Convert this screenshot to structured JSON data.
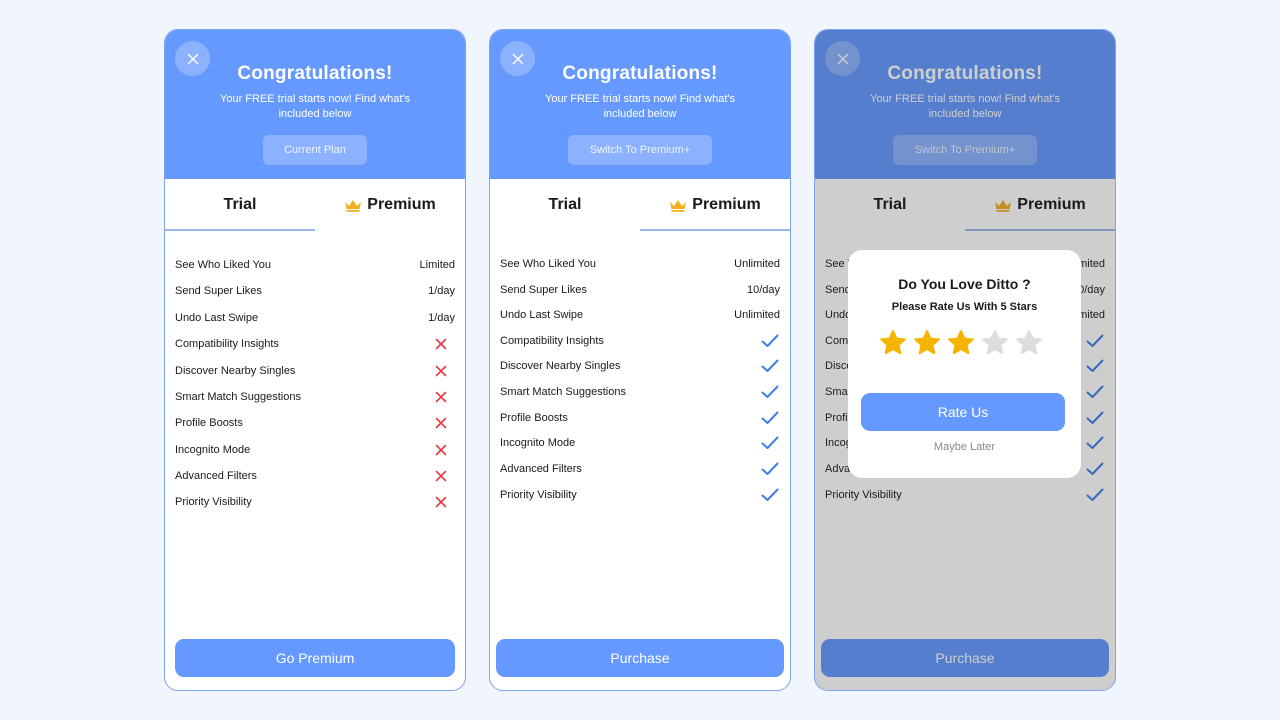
{
  "header": {
    "title": "Congratulations!",
    "subtitle": "Your FREE trial starts now! Find what's included below"
  },
  "tabs": {
    "trial": "Trial",
    "premium": "Premium"
  },
  "colors": {
    "primary": "#6699ff",
    "x_mark": "#e63946",
    "check_mark": "#3f7fe6",
    "star_filled": "#f4b400",
    "star_empty": "#dddddd",
    "crown": "#f2b01e"
  },
  "cards": [
    {
      "header_button": "Current Plan",
      "active_tab": "trial",
      "features": [
        {
          "name": "See Who Liked You",
          "value": "Limited"
        },
        {
          "name": "Send Super Likes",
          "value": "1/day"
        },
        {
          "name": "Undo Last Swipe",
          "value": "1/day"
        },
        {
          "name": "Compatibility Insights",
          "mark": "x-icon"
        },
        {
          "name": "Discover Nearby Singles",
          "mark": "x-icon"
        },
        {
          "name": "Smart Match Suggestions",
          "mark": "x-icon"
        },
        {
          "name": "Profile Boosts",
          "mark": "x-icon"
        },
        {
          "name": "Incognito Mode",
          "mark": "x-icon"
        },
        {
          "name": "Advanced Filters",
          "mark": "x-icon"
        },
        {
          "name": "Priority Visibility",
          "mark": "x-icon"
        }
      ],
      "cta": "Go Premium"
    },
    {
      "header_button": "Switch To Premium+",
      "active_tab": "premium",
      "features": [
        {
          "name": "See Who Liked You",
          "value": "Unlimited"
        },
        {
          "name": "Send Super Likes",
          "value": "10/day"
        },
        {
          "name": "Undo Last Swipe",
          "value": "Unlimited"
        },
        {
          "name": "Compatibility Insights",
          "mark": "check-icon"
        },
        {
          "name": "Discover Nearby Singles",
          "mark": "check-icon"
        },
        {
          "name": "Smart Match Suggestions",
          "mark": "check-icon"
        },
        {
          "name": "Profile Boosts",
          "mark": "check-icon"
        },
        {
          "name": "Incognito Mode",
          "mark": "check-icon"
        },
        {
          "name": "Advanced Filters",
          "mark": "check-icon"
        },
        {
          "name": "Priority Visibility",
          "mark": "check-icon"
        }
      ],
      "cta": "Purchase"
    },
    {
      "header_button": "Switch To Premium+",
      "active_tab": "premium",
      "features": [
        {
          "name": "See Who Liked You",
          "value": "Unlimited"
        },
        {
          "name": "Send Super Likes",
          "value": "10/day"
        },
        {
          "name": "Undo Last Swipe",
          "value": "Unlimited"
        },
        {
          "name": "Compatibility Insights",
          "mark": "check-icon"
        },
        {
          "name": "Discover Nearby Singles",
          "mark": "check-icon"
        },
        {
          "name": "Smart Match Suggestions",
          "mark": "check-icon"
        },
        {
          "name": "Profile Boosts",
          "mark": "check-icon"
        },
        {
          "name": "Incognito Mode",
          "mark": "check-icon"
        },
        {
          "name": "Advanced Filters",
          "mark": "check-icon"
        },
        {
          "name": "Priority Visibility",
          "mark": "check-icon"
        }
      ],
      "cta": "Purchase"
    }
  ],
  "rating_dialog": {
    "title": "Do You Love Ditto ?",
    "subtitle": "Please Rate Us With 5 Stars",
    "rating": 3,
    "max_rating": 5,
    "primary_button": "Rate Us",
    "secondary_link": "Maybe Later"
  }
}
